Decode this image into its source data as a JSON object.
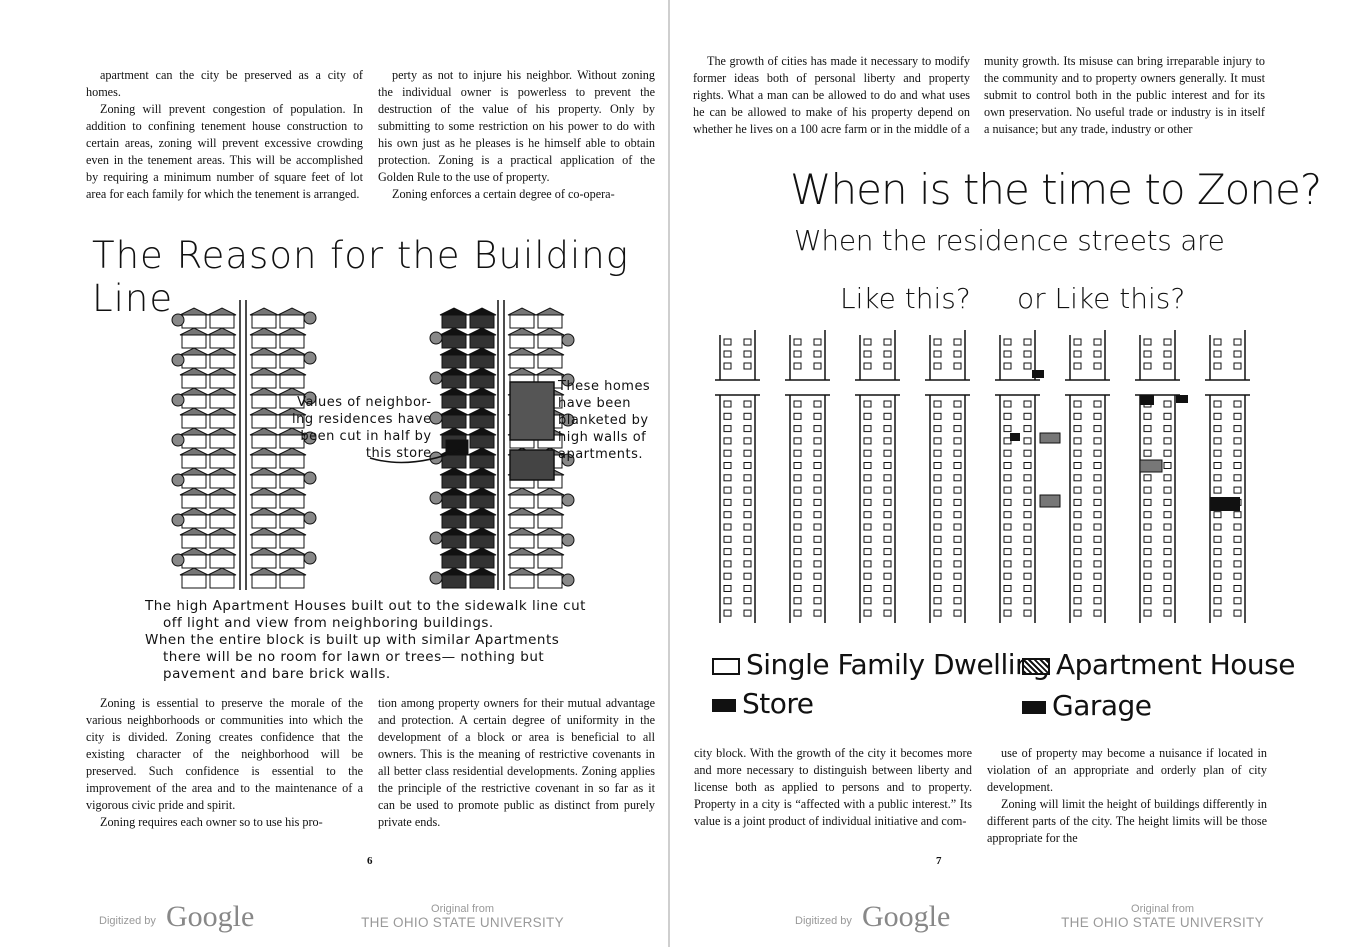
{
  "left_page": {
    "col1_top": [
      "apartment can the city be preserved as a city of homes.",
      "Zoning will prevent congestion of population. In addition to confining tenement house construction to certain areas, zoning will prevent excessive crowding even in the tenement areas. This will be accomplished by requiring a minimum number of square feet of lot area for each family for which the tenement is arranged."
    ],
    "col2_top": [
      "perty as not to injure his neighbor. Without zoning the individual owner is powerless to prevent the destruction of the value of his property. Only by submitting to some restriction on his power to do with his own just as he pleases is he himself able to obtain protection. Zoning is a practical application of the Golden Rule to the use of property.",
      "Zoning enforces a certain degree of co-opera-"
    ],
    "figure_title": "The Reason for the Building Line",
    "annotation_left": [
      "Values of neighbor-",
      "ing residences have",
      "been cut in half by",
      "this store"
    ],
    "annotation_right": [
      "These homes",
      "have been",
      "blanketed by",
      "high walls of",
      "apartments."
    ],
    "caption": [
      "The high Apartment Houses built out to the sidewalk line cut",
      "off light and view from neighboring buildings.",
      "When the entire block is built up with similar Apartments",
      "there will be no room for lawn or trees—   nothing but",
      "pavement and bare brick walls."
    ],
    "col1_bottom": [
      "Zoning is essential to preserve the morale of the various neighborhoods or communities into which the city is divided. Zoning creates confidence that the existing character of the neighborhood will be preserved. Such confidence is essential to the improvement of the area and to the maintenance of a vigorous civic pride and spirit.",
      "Zoning requires each owner so to use his pro-"
    ],
    "col2_bottom": [
      "tion among property owners for their mutual advantage and protection. A certain degree of uniformity in the development of a block or area is beneficial to all owners. This is the meaning of restrictive covenants in all better class residential developments. Zoning applies the principle of the restrictive covenant in so far as it can be used to promote public as distinct from purely private ends."
    ],
    "page_number": "6"
  },
  "right_page": {
    "col1_top": [
      "The growth of cities has made it necessary to modify former ideas both of personal liberty and property rights. What a man can be allowed to do and what uses he can be allowed to make of his property depend on whether he lives on a 100 acre farm or in the middle of a"
    ],
    "col2_top": [
      "munity growth. Its misuse can bring irreparable injury to the community and to property owners generally. It must submit to control both in the public interest and for its own preservation. No useful trade or industry is in itself a nuisance; but any trade, industry or other"
    ],
    "figure_title": "When is the time to Zone?",
    "figure_subtitle": "When the residence streets are",
    "label_left": "Like this?",
    "label_right": "or Like this?",
    "legend": {
      "single": "Single Family Dwelling",
      "apartment": "Apartment House",
      "store": "Store",
      "garage": "Garage"
    },
    "col1_bottom": [
      "city block. With the growth of the city it becomes more and more necessary to distinguish between liberty and license both as applied to persons and to property. Property in a city is “affected with a public interest.” Its value is a joint product of individual initiative and com-"
    ],
    "col2_bottom": [
      "use of property may become a nuisance if located in violation of an appropriate and orderly plan of city development.",
      "Zoning will limit the height of buildings differently in different parts of the city. The height limits will be those appropriate for the"
    ],
    "page_number": "7"
  },
  "footer": {
    "digitized_by": "Digitized by",
    "google": "Google",
    "original_from": "Original from",
    "university": "THE OHIO STATE UNIVERSITY"
  }
}
